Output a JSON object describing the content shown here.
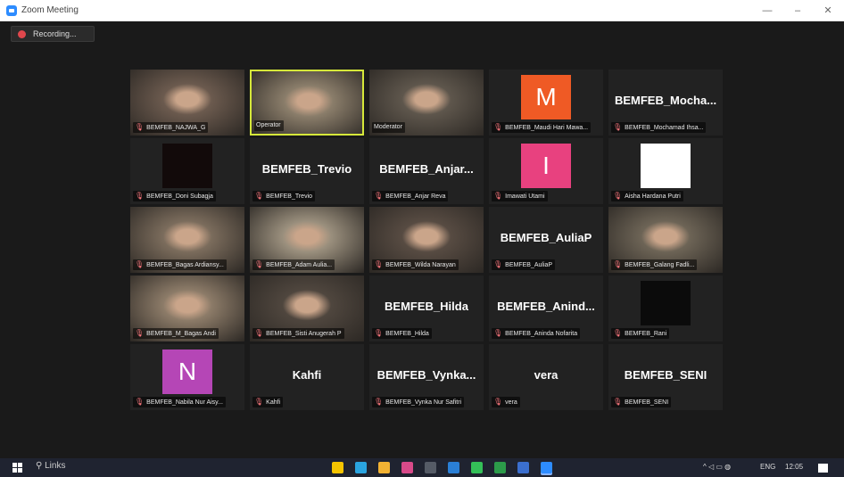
{
  "window": {
    "title": "Zoom Meeting",
    "minimize": "—",
    "maximize": "–",
    "close": "✕"
  },
  "recording": {
    "label": "Recording..."
  },
  "participants": [
    {
      "type": "video",
      "name": "BEMFEB_NAJWA_G"
    },
    {
      "type": "video",
      "name": "Operator",
      "active": true
    },
    {
      "type": "video",
      "name": "Moderator"
    },
    {
      "type": "letter",
      "letter": "M",
      "color": "#ef5a25",
      "name": "BEMFEB_Maudi Hari Mawa..."
    },
    {
      "type": "text",
      "display": "BEMFEB_Mocha...",
      "name": "BEMFEB_Mochamad Ihsa..."
    },
    {
      "type": "blank",
      "color": "#120a0a",
      "name": "BEMFEB_Doni Subagja"
    },
    {
      "type": "text",
      "display": "BEMFEB_Trevio",
      "name": "BEMFEB_Trevio"
    },
    {
      "type": "text",
      "display": "BEMFEB_Anjar...",
      "name": "BEMFEB_Anjar Reva"
    },
    {
      "type": "letter",
      "letter": "I",
      "color": "#e8417f",
      "name": "Imawati Utami"
    },
    {
      "type": "blank",
      "color": "#ffffff",
      "name": "Aisha Hardana Putri"
    },
    {
      "type": "video",
      "name": "BEMFEB_Bagas Ardiansy..."
    },
    {
      "type": "video",
      "name": "BEMFEB_Adam Aulia..."
    },
    {
      "type": "video",
      "name": "BEMFEB_Wilda Narayan"
    },
    {
      "type": "text",
      "display": "BEMFEB_AuliaP",
      "name": "BEMFEB_AuliaP"
    },
    {
      "type": "video",
      "name": "BEMFEB_Galang Fadli..."
    },
    {
      "type": "video",
      "name": "BEMFEB_M_Bagas Andi"
    },
    {
      "type": "video",
      "name": "BEMFEB_Sisti Anugerah P"
    },
    {
      "type": "text",
      "display": "BEMFEB_Hilda",
      "name": "BEMFEB_Hilda"
    },
    {
      "type": "text",
      "display": "BEMFEB_Anind...",
      "name": "BEMFEB_Aninda Nofarita"
    },
    {
      "type": "blank",
      "color": "#0b0b0b",
      "name": "BEMFEB_Rani"
    },
    {
      "type": "letter",
      "letter": "N",
      "color": "#b546b6",
      "name": "BEMFEB_Nabila Nur Aisy..."
    },
    {
      "type": "text",
      "display": "Kahfi",
      "name": "Kahfi"
    },
    {
      "type": "text",
      "display": "BEMFEB_Vynka...",
      "name": "BEMFEB_Vynka Nur Safitri"
    },
    {
      "type": "text",
      "display": "vera",
      "name": "vera"
    },
    {
      "type": "text",
      "display": "BEMFEB_SENI",
      "name": "BEMFEB_SENI"
    }
  ],
  "taskbar": {
    "search_label": "Links",
    "tray_lang": "ENG",
    "tray_time": "12:05",
    "pinned_apps": [
      {
        "icon": "file-explorer-icon",
        "color": "#f5c400"
      },
      {
        "icon": "edge-icon",
        "color": "#2aa4e0"
      },
      {
        "icon": "chrome-icon",
        "color": "#f2b233"
      },
      {
        "icon": "media-icon",
        "color": "#d84a8a"
      },
      {
        "icon": "calculator-icon",
        "color": "#555b66"
      },
      {
        "icon": "store-icon",
        "color": "#2a7fd6"
      },
      {
        "icon": "whatsapp-icon",
        "color": "#34c058"
      },
      {
        "icon": "excel-icon",
        "color": "#2c9b4a"
      },
      {
        "icon": "word-icon",
        "color": "#3b6fcf"
      },
      {
        "icon": "zoom-icon",
        "color": "#2d8cff"
      }
    ]
  },
  "colors": {
    "meeting_bg": "#1a1a1a",
    "tile_bg": "#222222",
    "active_border": "#d6e83a",
    "mute_red": "#e0474c"
  }
}
